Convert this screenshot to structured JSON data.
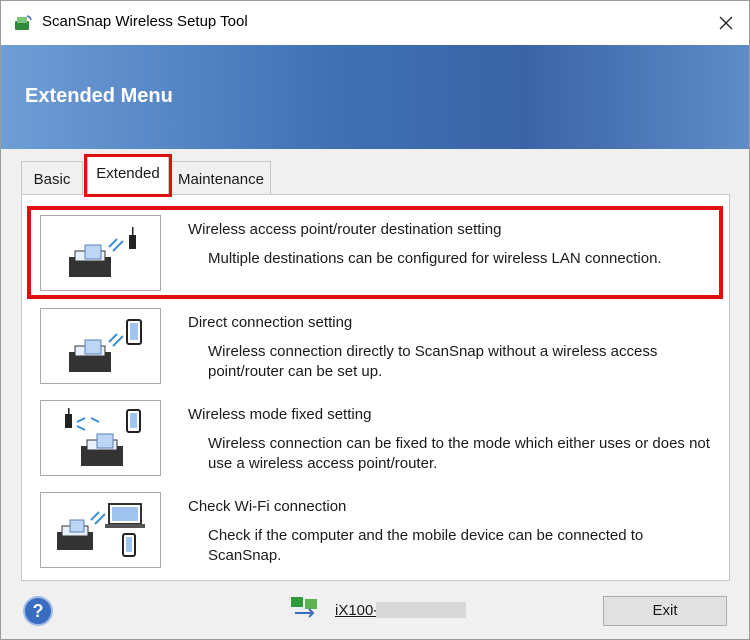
{
  "window": {
    "title": "ScanSnap Wireless Setup Tool"
  },
  "header": {
    "title": "Extended Menu"
  },
  "tabs": [
    {
      "label": "Basic"
    },
    {
      "label": "Extended"
    },
    {
      "label": "Maintenance"
    }
  ],
  "options": [
    {
      "title": "Wireless access point/router destination setting",
      "description": "Multiple destinations can be configured for wireless LAN connection.",
      "icon": "scanner-router-icon"
    },
    {
      "title": "Direct connection setting",
      "description": "Wireless connection directly to ScanSnap without a wireless access point/router can be set up.",
      "icon": "scanner-phone-icon"
    },
    {
      "title": "Wireless mode fixed setting",
      "description": "Wireless connection can be fixed to the mode which either uses or does not use a wireless access point/router.",
      "icon": "scanner-router-phone-icon"
    },
    {
      "title": "Check Wi-Fi connection",
      "description": "Check if the computer and the mobile device can be connected to ScanSnap.",
      "icon": "scanner-laptop-phone-icon"
    }
  ],
  "footer": {
    "device_label": "iX100-",
    "exit_label": "Exit"
  },
  "colors": {
    "highlight": "#e01010",
    "header_band": "#3f70b4",
    "help": "#3a6cc0"
  }
}
